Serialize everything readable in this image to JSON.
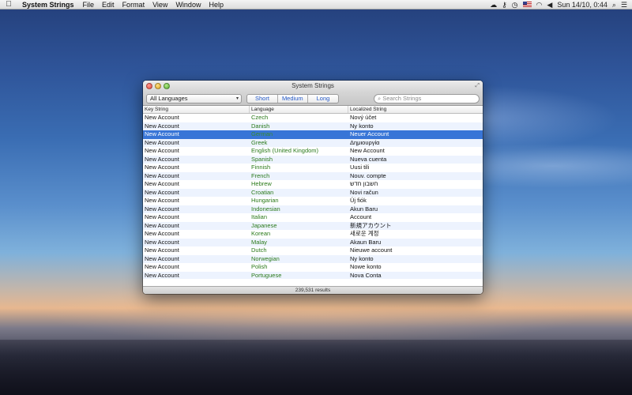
{
  "menubar": {
    "app_name": "System Strings",
    "items": [
      "File",
      "Edit",
      "Format",
      "View",
      "Window",
      "Help"
    ],
    "clock": "Sun 14/10, 0:44"
  },
  "window": {
    "title": "System Strings",
    "language_select": "All Languages",
    "segments": [
      "Short",
      "Medium",
      "Long"
    ],
    "search_placeholder": "Search Strings",
    "columns": {
      "key": "Key String",
      "language": "Language",
      "localized": "Localized String"
    },
    "rows": [
      {
        "key": "New Account",
        "language": "Czech",
        "localized": "Nový účet"
      },
      {
        "key": "New Account",
        "language": "Danish",
        "localized": "Ny konto"
      },
      {
        "key": "New Account",
        "language": "German",
        "localized": "Neuer Account",
        "selected": true
      },
      {
        "key": "New Account",
        "language": "Greek",
        "localized": "Δημιουργία"
      },
      {
        "key": "New Account",
        "language": "English (United Kingdom)",
        "localized": "New Account"
      },
      {
        "key": "New Account",
        "language": "Spanish",
        "localized": "Nueva cuenta"
      },
      {
        "key": "New Account",
        "language": "Finnish",
        "localized": "Uusi tili"
      },
      {
        "key": "New Account",
        "language": "French",
        "localized": "Nouv. compte"
      },
      {
        "key": "New Account",
        "language": "Hebrew",
        "localized": "חשבון חדש"
      },
      {
        "key": "New Account",
        "language": "Croatian",
        "localized": "Novi račun"
      },
      {
        "key": "New Account",
        "language": "Hungarian",
        "localized": "Új fiók"
      },
      {
        "key": "New Account",
        "language": "Indonesian",
        "localized": "Akun Baru"
      },
      {
        "key": "New Account",
        "language": "Italian",
        "localized": "Account"
      },
      {
        "key": "New Account",
        "language": "Japanese",
        "localized": "新規アカウント"
      },
      {
        "key": "New Account",
        "language": "Korean",
        "localized": "새로운 계정"
      },
      {
        "key": "New Account",
        "language": "Malay",
        "localized": "Akaun Baru"
      },
      {
        "key": "New Account",
        "language": "Dutch",
        "localized": "Nieuwe account"
      },
      {
        "key": "New Account",
        "language": "Norwegian",
        "localized": "Ny konto"
      },
      {
        "key": "New Account",
        "language": "Polish",
        "localized": "Nowe konto"
      },
      {
        "key": "New Account",
        "language": "Portuguese",
        "localized": "Nova Conta"
      }
    ],
    "status": "239,531 results"
  },
  "colors": {
    "selection": "#3875d7",
    "language_text": "#2b7a1a",
    "segment_text": "#2459c9"
  },
  "icons": {
    "menubar_status": [
      "cloud-icon",
      "key-icon",
      "clock-icon",
      "flag-icon",
      "wifi-icon",
      "volume-icon",
      "spotlight-icon",
      "list-icon"
    ]
  }
}
